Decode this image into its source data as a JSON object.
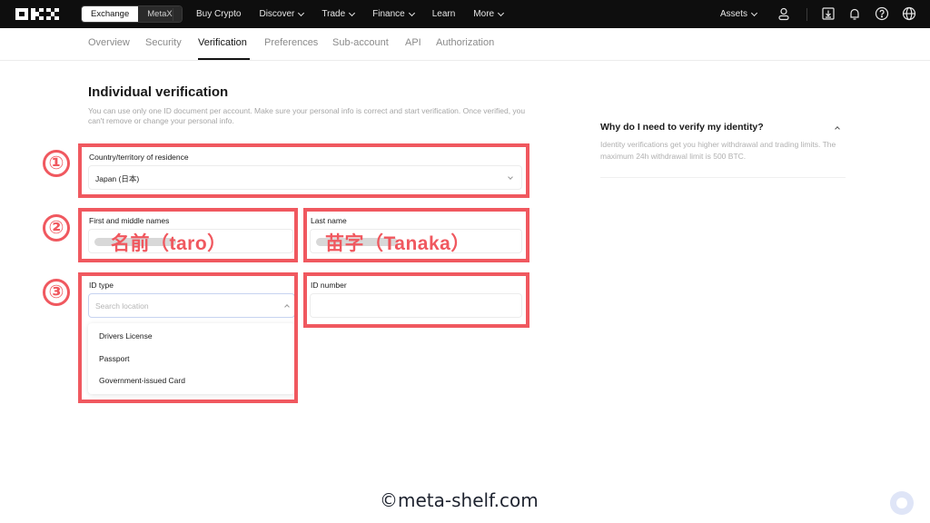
{
  "topbar": {
    "logo": "OKX",
    "mode_toggle": {
      "active": "Exchange",
      "inactive": "MetaX"
    },
    "nav": [
      {
        "label": "Buy Crypto",
        "dropdown": false
      },
      {
        "label": "Discover",
        "dropdown": true
      },
      {
        "label": "Trade",
        "dropdown": true
      },
      {
        "label": "Finance",
        "dropdown": true
      },
      {
        "label": "Learn",
        "dropdown": false
      },
      {
        "label": "More",
        "dropdown": true
      }
    ],
    "assets_label": "Assets",
    "icons": [
      "user-icon",
      "download-icon",
      "bell-icon",
      "help-icon",
      "globe-icon"
    ]
  },
  "subtabs": {
    "items": [
      "Overview",
      "Security",
      "Verification",
      "Preferences",
      "Sub-account",
      "API",
      "Authorization"
    ],
    "active": "Verification"
  },
  "main": {
    "title": "Individual verification",
    "description": "You can use only one ID document per account. Make sure your personal info is correct and start verification. Once verified, you can't remove or change your personal info.",
    "country": {
      "label": "Country/territory of residence",
      "value": "Japan (日本)"
    },
    "first_name": {
      "label": "First and middle names",
      "annotation": "名前（taro）"
    },
    "last_name": {
      "label": "Last name",
      "annotation": "苗字（Tanaka）"
    },
    "id_type": {
      "label": "ID type",
      "placeholder": "Search location",
      "options": [
        "Drivers License",
        "Passport",
        "Government-issued Card"
      ]
    },
    "id_number": {
      "label": "ID number",
      "value": ""
    }
  },
  "annotations": {
    "step1": "①",
    "step2": "②",
    "step3": "③"
  },
  "faq": {
    "title": "Why do I need to verify my identity?",
    "text": "Identity verifications get you higher withdrawal and trading limits. The maximum 24h withdrawal limit is 500 BTC."
  },
  "watermark": "©meta-shelf.com",
  "colors": {
    "annotation": "#f0585f",
    "topbar": "#0e0e0e"
  }
}
